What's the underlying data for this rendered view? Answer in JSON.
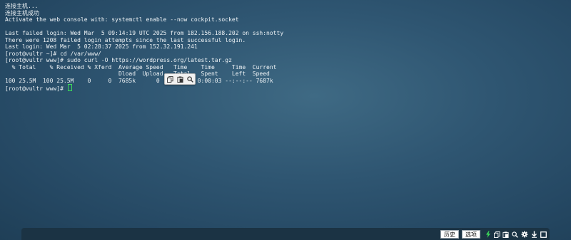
{
  "terminal": {
    "lines": [
      "连接主机...",
      "连接主机成功",
      "Activate the web console with: systemctl enable --now cockpit.socket",
      "",
      "Last failed login: Wed Mar  5 09:14:19 UTC 2025 from 182.156.188.202 on ssh:notty",
      "There were 1208 failed login attempts since the last successful login.",
      "Last login: Wed Mar  5 02:28:37 2025 from 152.32.191.241",
      "[root@vultr ~]# cd /var/www/",
      "[root@vultr www]# sudo curl -O https://wordpress.org/latest.tar.gz",
      "  % Total    % Received % Xferd  Average Speed   Time    Time     Time  Current",
      "                                 Dload  Upload   Total   Spent    Left  Speed",
      "100 25.5M  100 25.5M    0     0  7685k      0  0:00:03  0:00:03 --:--:-- 7687k"
    ],
    "prompt": "[root@vultr www]# "
  },
  "bottom_bar": {
    "history_label": "历史",
    "options_label": "选项"
  },
  "colors": {
    "cursor": "#3ddc5a",
    "lightning": "#3ddc5a",
    "bar_background": "#1b3344"
  },
  "icons": {
    "float_toolbar": [
      "copy-icon",
      "paste-icon",
      "search-icon"
    ],
    "bottom_bar": [
      "lightning-icon",
      "copy-icon",
      "paste-icon",
      "search-icon",
      "gear-icon",
      "download-icon",
      "fullscreen-icon"
    ]
  }
}
